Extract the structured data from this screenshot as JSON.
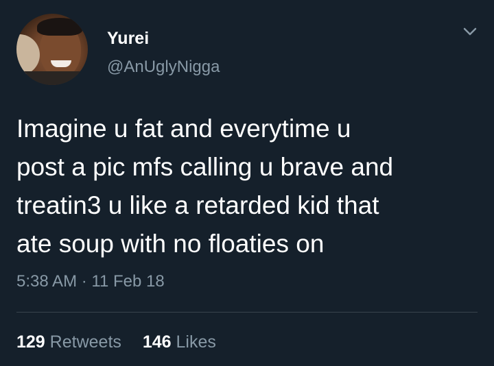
{
  "tweet": {
    "author": {
      "name": "Yurei",
      "handle": "@AnUglyNigga"
    },
    "text": "Imagine u fat and everytime u\npost a pic mfs calling u brave and\ntreatin3 u like a retarded kid that\nate soup with no floaties on",
    "timestamp": "5:38 AM · 11 Feb 18",
    "stats": {
      "retweets_count": "129",
      "retweets_label": "Retweets",
      "likes_count": "146",
      "likes_label": "Likes"
    },
    "menu_icon": "chevron-down-icon"
  },
  "colors": {
    "background": "#15202b",
    "primary_text": "#ffffff",
    "secondary_text": "#8899a6",
    "divider": "#38444d"
  }
}
